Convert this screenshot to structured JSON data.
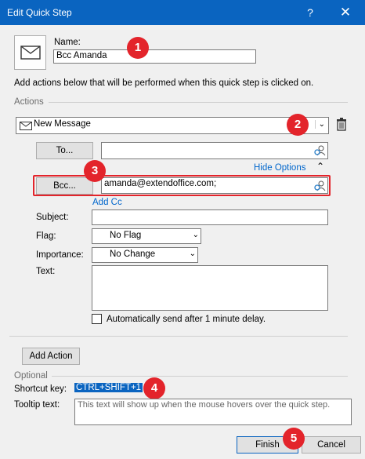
{
  "window": {
    "title": "Edit Quick Step",
    "help": "?",
    "close": "✕"
  },
  "name": {
    "label": "Name:",
    "value": "Bcc Amanda"
  },
  "description": "Add actions below that will be performed when this quick step is clicked on.",
  "actions_group_label": "Actions",
  "action": {
    "selected": "New Message"
  },
  "to": {
    "button": "To...",
    "value": ""
  },
  "hide_options": "Hide Options",
  "bcc": {
    "button": "Bcc...",
    "value": "amanda@extendoffice.com;"
  },
  "add_cc": "Add Cc",
  "subject": {
    "label": "Subject:",
    "value": ""
  },
  "flag": {
    "label": "Flag:",
    "value": "No Flag"
  },
  "importance": {
    "label": "Importance:",
    "value": "No Change"
  },
  "text": {
    "label": "Text:",
    "value": ""
  },
  "auto_send": {
    "label": "Automatically send after 1 minute delay.",
    "checked": false
  },
  "add_action": "Add Action",
  "optional_label": "Optional",
  "shortcut": {
    "label": "Shortcut key:",
    "value": "CTRL+SHIFT+1"
  },
  "tooltip": {
    "label": "Tooltip text:",
    "placeholder": "This text will show up when the mouse hovers over the quick step."
  },
  "finish": "Finish",
  "cancel": "Cancel",
  "badges": [
    "1",
    "2",
    "3",
    "4",
    "5"
  ],
  "colors": {
    "titlebar": "#0a64c0",
    "badge": "#e3242b",
    "link": "#0066cc"
  }
}
